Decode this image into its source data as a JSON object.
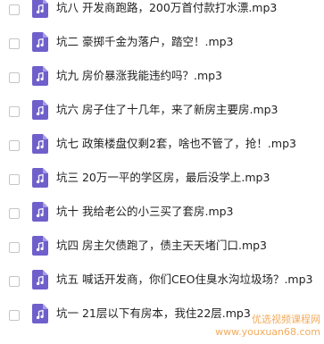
{
  "file_list": {
    "icon": "audio-file-icon",
    "accent_color": "#6f5fcb",
    "items": [
      {
        "name": "坑八 开发商跑路，200万首付款打水漂.mp3"
      },
      {
        "name": "坑二 豪掷千金为落户，踏空！.mp3"
      },
      {
        "name": "坑九 房价暴涨我能违约吗？.mp3"
      },
      {
        "name": "坑六 房子住了十几年，来了新房主要房.mp3"
      },
      {
        "name": "坑七 政策楼盘仅剩2套，啥也不管了，抢！.mp3"
      },
      {
        "name": "坑三 20万一平的学区房，最后没学上.mp3"
      },
      {
        "name": "坑十 我给老公的小三买了套房.mp3"
      },
      {
        "name": "坑四 房主欠债跑了，债主天天堵门口.mp3"
      },
      {
        "name": "坑五 喊话开发商，你们CEO住臭水沟垃圾场？.mp3"
      },
      {
        "name": "坑一 21层以下有房本，我住22层.mp3"
      }
    ]
  },
  "watermark": {
    "line1": "优选视频课程网",
    "line2": "www.youxuan68.com"
  }
}
